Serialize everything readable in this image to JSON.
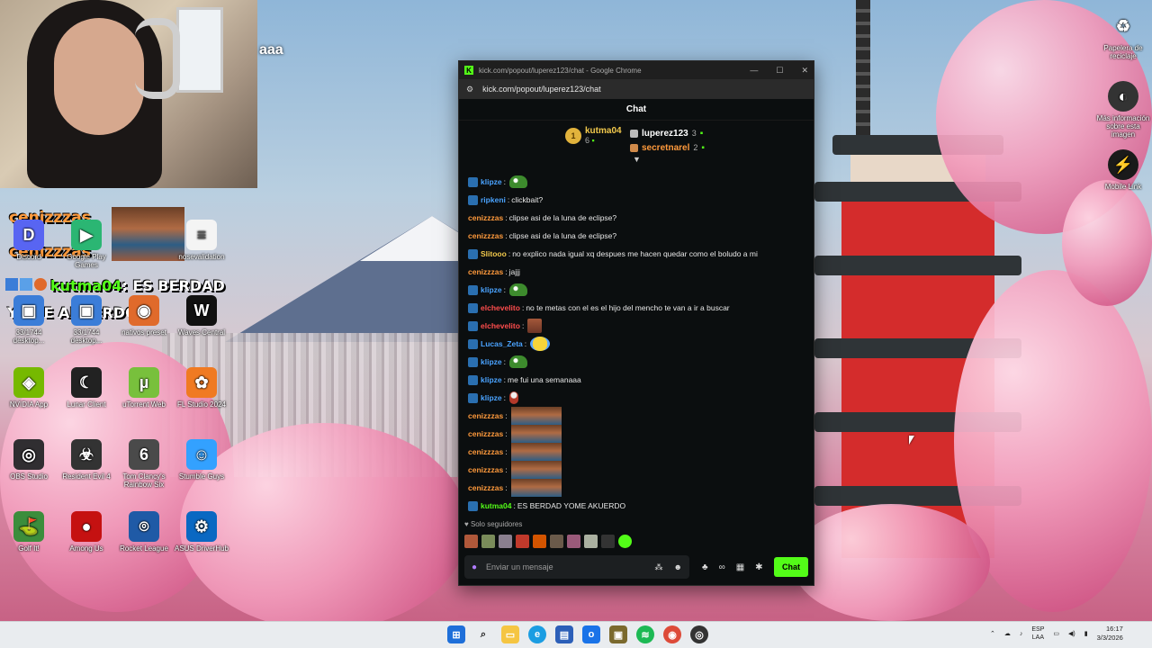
{
  "desktop": {
    "webcam_overlay_text": "aaa",
    "overlay_comment_top": "cenizzzas",
    "overlay_comment_top2": "cenizzzas",
    "overlay_comment_main_user": "kutma04",
    "overlay_comment_main_text": ": ES BERDAD",
    "overlay_comment_main_line2": "YOME AKUERDO",
    "icons": [
      {
        "label": "Discord",
        "color": "#5865f2",
        "glyph": "D"
      },
      {
        "label": "Google Play Games",
        "color": "#2bb673",
        "glyph": "▶"
      },
      {
        "label": "nosevalidation",
        "color": "#f4f4f4",
        "glyph": "≡"
      },
      {
        "label": "33/1744 desktop...",
        "color": "#3b7dd8",
        "glyph": "▣"
      },
      {
        "label": "33/1744 desktop...",
        "color": "#3b7dd8",
        "glyph": "▣"
      },
      {
        "label": "nativos preset",
        "color": "#e06a2b",
        "glyph": "◉"
      },
      {
        "label": "Waves Central",
        "color": "#111",
        "glyph": "W"
      },
      {
        "label": "NVIDIA App",
        "color": "#76b900",
        "glyph": "◈"
      },
      {
        "label": "Lunar Client",
        "color": "#222",
        "glyph": "☾"
      },
      {
        "label": "uTorrent Web",
        "color": "#78c03c",
        "glyph": "µ"
      },
      {
        "label": "FL Studio 2024",
        "color": "#f07a22",
        "glyph": "✿"
      },
      {
        "label": "OBS Studio",
        "color": "#302e31",
        "glyph": "◎"
      },
      {
        "label": "Resident Evil 4",
        "color": "#333",
        "glyph": "☣"
      },
      {
        "label": "Tom Clancy's Rainbow Six",
        "color": "#4a4a4a",
        "glyph": "6"
      },
      {
        "label": "Stumble Guys",
        "color": "#33a1ff",
        "glyph": "☺"
      },
      {
        "label": "Golf It!",
        "color": "#3c8d3c",
        "glyph": "⛳"
      },
      {
        "label": "Among Us",
        "color": "#c51111",
        "glyph": "●"
      },
      {
        "label": "Rocket League",
        "color": "#1f5aa6",
        "glyph": "⌾"
      },
      {
        "label": "ASUS DriverHub",
        "color": "#0a68c2",
        "glyph": "⚙"
      }
    ],
    "right_icons": [
      {
        "label": "Papelera de reciclaje",
        "glyph": "♻"
      },
      {
        "label": "Más información sobre esta imagen",
        "glyph": "◐"
      },
      {
        "label": "Mobile Link",
        "glyph": "⚡"
      }
    ]
  },
  "browser": {
    "window_title": "kick.com/popout/luperez123/chat - Google Chrome",
    "url": "kick.com/popout/luperez123/chat",
    "minimize": "—",
    "maximize": "☐",
    "close": "✕"
  },
  "chat": {
    "header": "Chat",
    "leaderboard": {
      "first": {
        "rank": "1",
        "name": "kutma04",
        "count": "6"
      },
      "second": {
        "name": "luperez123",
        "count": "3"
      },
      "third": {
        "name": "secretnarel",
        "count": "2"
      }
    },
    "messages": [
      {
        "user": "klipze",
        "color": "#4aa3ff",
        "text": "",
        "emote": "frog"
      },
      {
        "user": "ripkeni",
        "color": "#4aa3ff",
        "text": "clickbait?",
        "emote": ""
      },
      {
        "user": "cenizzzas",
        "color": "#ff9a3c",
        "text": "clipse asi de la luna de eclipse?",
        "emote": ""
      },
      {
        "user": "cenizzzas",
        "color": "#ff9a3c",
        "text": "clipse asi de la luna de eclipse?",
        "emote": ""
      },
      {
        "user": "Slitooo",
        "color": "#f2c94c",
        "text": "no explico nada igual xq despues me hacen quedar como el boludo a mi",
        "emote": ""
      },
      {
        "user": "cenizzzas",
        "color": "#ff9a3c",
        "text": "jajjj",
        "emote": ""
      },
      {
        "user": "klipze",
        "color": "#4aa3ff",
        "text": "",
        "emote": "frog"
      },
      {
        "user": "elchevelito",
        "color": "#ff4d4d",
        "text": "no te metas con el es el hijo del mencho te van a ir a buscar",
        "emote": ""
      },
      {
        "user": "elchevelito",
        "color": "#ff4d4d",
        "text": "",
        "emote": "small-face"
      },
      {
        "user": "Lucas_Zeta",
        "color": "#4aa3ff",
        "text": "",
        "emote": "laugh"
      },
      {
        "user": "klipze",
        "color": "#4aa3ff",
        "text": "",
        "emote": "frog"
      },
      {
        "user": "klipze",
        "color": "#4aa3ff",
        "text": "me fui una semanaaa",
        "emote": ""
      },
      {
        "user": "klipze",
        "color": "#4aa3ff",
        "text": "",
        "emote": "pepe"
      },
      {
        "user": "cenizzzas",
        "color": "#ff9a3c",
        "text": "",
        "emote": "face"
      },
      {
        "user": "cenizzzas",
        "color": "#ff9a3c",
        "text": "",
        "emote": "face"
      },
      {
        "user": "cenizzzas",
        "color": "#ff9a3c",
        "text": "",
        "emote": "face"
      },
      {
        "user": "cenizzzas",
        "color": "#ff9a3c",
        "text": "",
        "emote": "face"
      },
      {
        "user": "cenizzzas",
        "color": "#ff9a3c",
        "text": "",
        "emote": "face"
      },
      {
        "user": "kutma04",
        "color": "#53fc18",
        "text": "ES BERDAD YOME AKUERDO",
        "emote": ""
      }
    ],
    "follower_mode": "♥ Solo seguidores",
    "input_placeholder": "Enviar un mensaje",
    "send_label": "Chat"
  },
  "taskbar": {
    "lang_top": "ESP",
    "lang_bottom": "LAA",
    "time": "16:17",
    "date": "3/3/2026"
  }
}
